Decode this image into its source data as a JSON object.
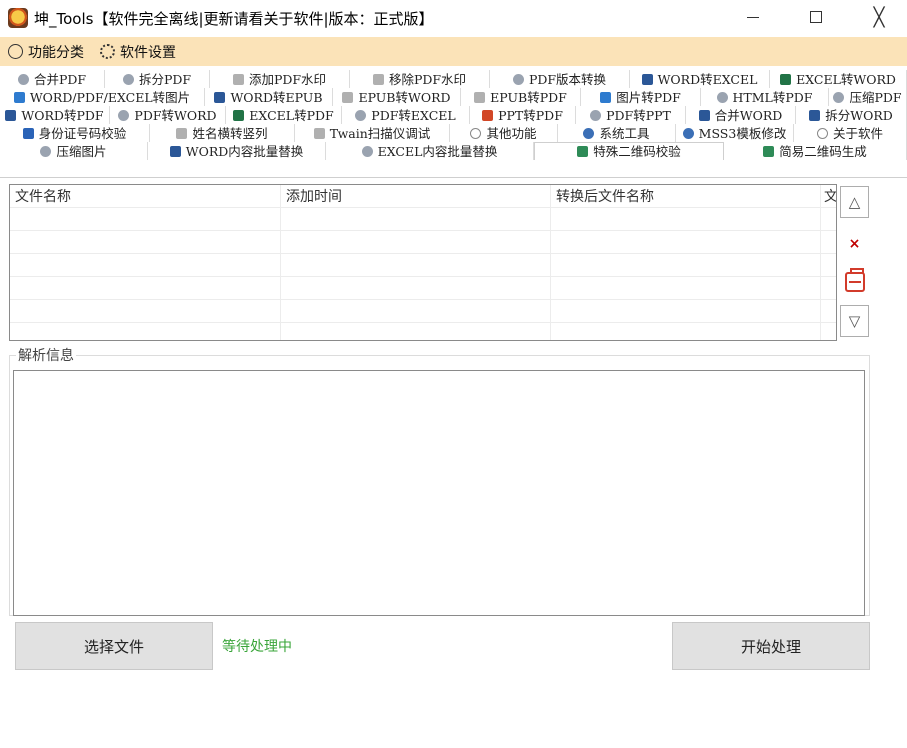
{
  "window": {
    "title": "坤_Tools【软件完全离线|更新请看关于软件|版本：正式版】",
    "minimize_icon": "minimize-icon",
    "maximize_icon": "maximize-icon",
    "close_icon": "close-icon",
    "close_glyph": "╳"
  },
  "menu": {
    "items": [
      {
        "label": "功能分类",
        "icon": "cube-icon"
      },
      {
        "label": "软件设置",
        "icon": "gear-icon"
      }
    ]
  },
  "tabs": {
    "rows": [
      [
        {
          "label": "合并PDF",
          "icon": "doc"
        },
        {
          "label": "拆分PDF",
          "icon": "doc"
        },
        {
          "label": "添加PDF水印",
          "icon": "gray"
        },
        {
          "label": "移除PDF水印",
          "icon": "gray"
        },
        {
          "label": "PDF版本转换",
          "icon": "doc"
        },
        {
          "label": "WORD转EXCEL",
          "icon": "word"
        },
        {
          "label": "EXCEL转WORD",
          "icon": "excel"
        }
      ],
      [
        {
          "label": "WORD/PDF/EXCEL转图片",
          "icon": "img"
        },
        {
          "label": "WORD转EPUB",
          "icon": "word"
        },
        {
          "label": "EPUB转WORD",
          "icon": "gray"
        },
        {
          "label": "EPUB转PDF",
          "icon": "gray"
        },
        {
          "label": "图片转PDF",
          "icon": "img"
        },
        {
          "label": "HTML转PDF",
          "icon": "doc"
        },
        {
          "label": "压缩PDF",
          "icon": "doc"
        }
      ],
      [
        {
          "label": "WORD转PDF",
          "icon": "word"
        },
        {
          "label": "PDF转WORD",
          "icon": "doc"
        },
        {
          "label": "EXCEL转PDF",
          "icon": "excel"
        },
        {
          "label": "PDF转EXCEL",
          "icon": "doc"
        },
        {
          "label": "PPT转PDF",
          "icon": "ppt"
        },
        {
          "label": "PDF转PPT",
          "icon": "doc"
        },
        {
          "label": "合并WORD",
          "icon": "word"
        },
        {
          "label": "拆分WORD",
          "icon": "word"
        }
      ],
      [
        {
          "label": "身份证号码校验",
          "icon": "id"
        },
        {
          "label": "姓名横转竖列",
          "icon": "gray"
        },
        {
          "label": "Twain扫描仪调试",
          "icon": "gray"
        },
        {
          "label": "其他功能",
          "icon": "info"
        },
        {
          "label": "系统工具",
          "icon": "gear"
        },
        {
          "label": "MSS3模板修改",
          "icon": "gear"
        },
        {
          "label": "关于软件",
          "icon": "info"
        }
      ],
      [
        {
          "label": "压缩图片",
          "icon": "doc"
        },
        {
          "label": "WORD内容批量替换",
          "icon": "word"
        },
        {
          "label": "EXCEL内容批量替换",
          "icon": "doc"
        },
        {
          "label": "特殊二维码校验",
          "icon": "qr",
          "active": true
        },
        {
          "label": "简易二维码生成",
          "icon": "qr"
        }
      ]
    ]
  },
  "file_list": {
    "columns": [
      "文件名称",
      "添加时间",
      "转换后文件名称",
      "文"
    ],
    "rows": []
  },
  "side_buttons": {
    "up": "△",
    "delete": "×",
    "down": "▽"
  },
  "info_box": {
    "label": "解析信息",
    "content": ""
  },
  "actions": {
    "select_file": "选择文件",
    "status": "等待处理中",
    "start": "开始处理"
  },
  "colors": {
    "menubar_bg": "#fbe3b8",
    "status_green": "#3aa53a",
    "delete_red": "#c00000"
  }
}
